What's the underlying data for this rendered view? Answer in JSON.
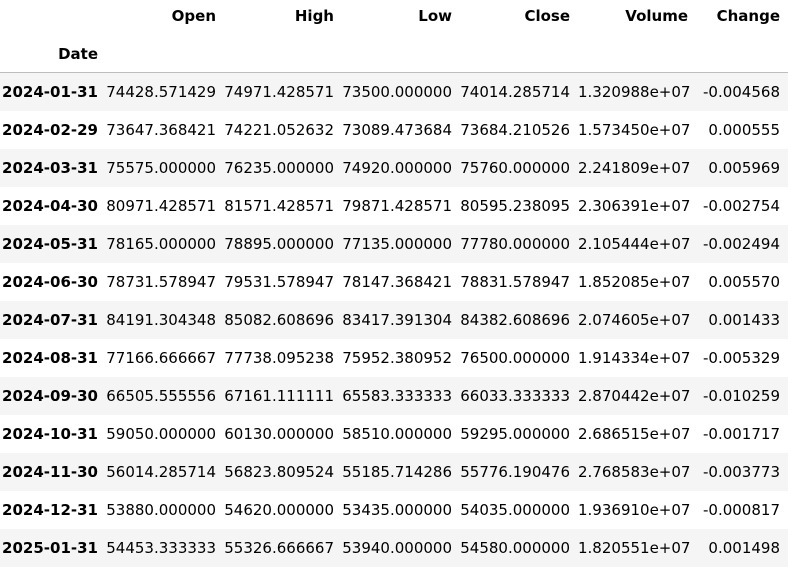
{
  "table": {
    "columns": [
      "Open",
      "High",
      "Low",
      "Close",
      "Volume",
      "Change"
    ],
    "index_name": "Date",
    "rows": [
      {
        "date": "2024-01-31",
        "values": [
          "74428.571429",
          "74971.428571",
          "73500.000000",
          "74014.285714",
          "1.320988e+07",
          "-0.004568"
        ]
      },
      {
        "date": "2024-02-29",
        "values": [
          "73647.368421",
          "74221.052632",
          "73089.473684",
          "73684.210526",
          "1.573450e+07",
          "0.000555"
        ]
      },
      {
        "date": "2024-03-31",
        "values": [
          "75575.000000",
          "76235.000000",
          "74920.000000",
          "75760.000000",
          "2.241809e+07",
          "0.005969"
        ]
      },
      {
        "date": "2024-04-30",
        "values": [
          "80971.428571",
          "81571.428571",
          "79871.428571",
          "80595.238095",
          "2.306391e+07",
          "-0.002754"
        ]
      },
      {
        "date": "2024-05-31",
        "values": [
          "78165.000000",
          "78895.000000",
          "77135.000000",
          "77780.000000",
          "2.105444e+07",
          "-0.002494"
        ]
      },
      {
        "date": "2024-06-30",
        "values": [
          "78731.578947",
          "79531.578947",
          "78147.368421",
          "78831.578947",
          "1.852085e+07",
          "0.005570"
        ]
      },
      {
        "date": "2024-07-31",
        "values": [
          "84191.304348",
          "85082.608696",
          "83417.391304",
          "84382.608696",
          "2.074605e+07",
          "0.001433"
        ]
      },
      {
        "date": "2024-08-31",
        "values": [
          "77166.666667",
          "77738.095238",
          "75952.380952",
          "76500.000000",
          "1.914334e+07",
          "-0.005329"
        ]
      },
      {
        "date": "2024-09-30",
        "values": [
          "66505.555556",
          "67161.111111",
          "65583.333333",
          "66033.333333",
          "2.870442e+07",
          "-0.010259"
        ]
      },
      {
        "date": "2024-10-31",
        "values": [
          "59050.000000",
          "60130.000000",
          "58510.000000",
          "59295.000000",
          "2.686515e+07",
          "-0.001717"
        ]
      },
      {
        "date": "2024-11-30",
        "values": [
          "56014.285714",
          "56823.809524",
          "55185.714286",
          "55776.190476",
          "2.768583e+07",
          "-0.003773"
        ]
      },
      {
        "date": "2024-12-31",
        "values": [
          "53880.000000",
          "54620.000000",
          "53435.000000",
          "54035.000000",
          "1.936910e+07",
          "-0.000817"
        ]
      },
      {
        "date": "2025-01-31",
        "values": [
          "54453.333333",
          "55326.666667",
          "53940.000000",
          "54580.000000",
          "1.820551e+07",
          "0.001498"
        ]
      }
    ]
  }
}
